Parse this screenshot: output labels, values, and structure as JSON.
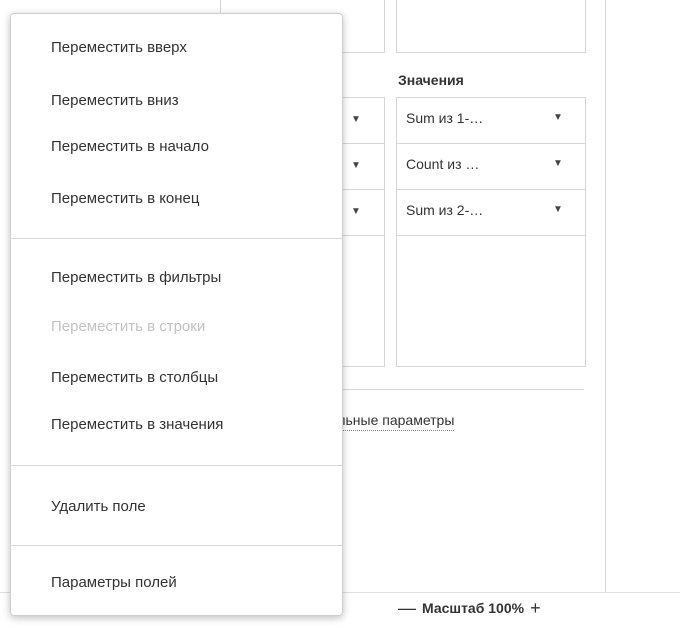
{
  "values_section": {
    "header": "Значения",
    "items": [
      {
        "label": "Sum из 1-…"
      },
      {
        "label": "Count из …"
      },
      {
        "label": "Sum из 2-…"
      }
    ]
  },
  "advanced_link": "ельные параметры",
  "zoom": {
    "minus": "—",
    "label": "Масштаб 100%",
    "plus": "+"
  },
  "context_menu": {
    "items": [
      {
        "label": "Переместить вверх",
        "enabled": true
      },
      {
        "label": "Переместить вниз",
        "enabled": true
      },
      {
        "label": "Переместить в начало",
        "enabled": true
      },
      {
        "label": "Переместить в конец",
        "enabled": true
      },
      {
        "label": "Переместить в фильтры",
        "enabled": true
      },
      {
        "label": "Переместить в строки",
        "enabled": false
      },
      {
        "label": "Переместить в столбцы",
        "enabled": true
      },
      {
        "label": "Переместить в значения",
        "enabled": true
      },
      {
        "label": "Удалить поле",
        "enabled": true
      },
      {
        "label": "Параметры полей",
        "enabled": true
      }
    ]
  },
  "icons": {
    "dropdown": "caret-down-icon"
  }
}
